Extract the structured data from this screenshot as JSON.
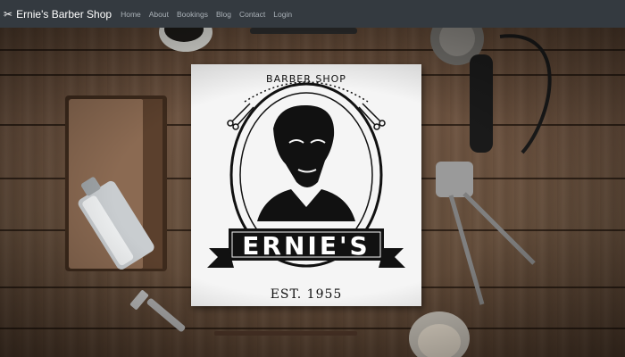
{
  "navbar": {
    "brand_icon": "scissors-icon",
    "brand": "Ernie's Barber Shop",
    "links": [
      "Home",
      "About",
      "Bookings",
      "Blog",
      "Contact",
      "Login"
    ]
  },
  "hero": {
    "logo": {
      "top_text": "BARBER SHOP",
      "name": "ERNIE'S",
      "est": "EST. 1955"
    }
  },
  "colors": {
    "navbar_bg": "#343a40",
    "navbar_link": "#a9b0b6",
    "wood": "#6d5340"
  }
}
